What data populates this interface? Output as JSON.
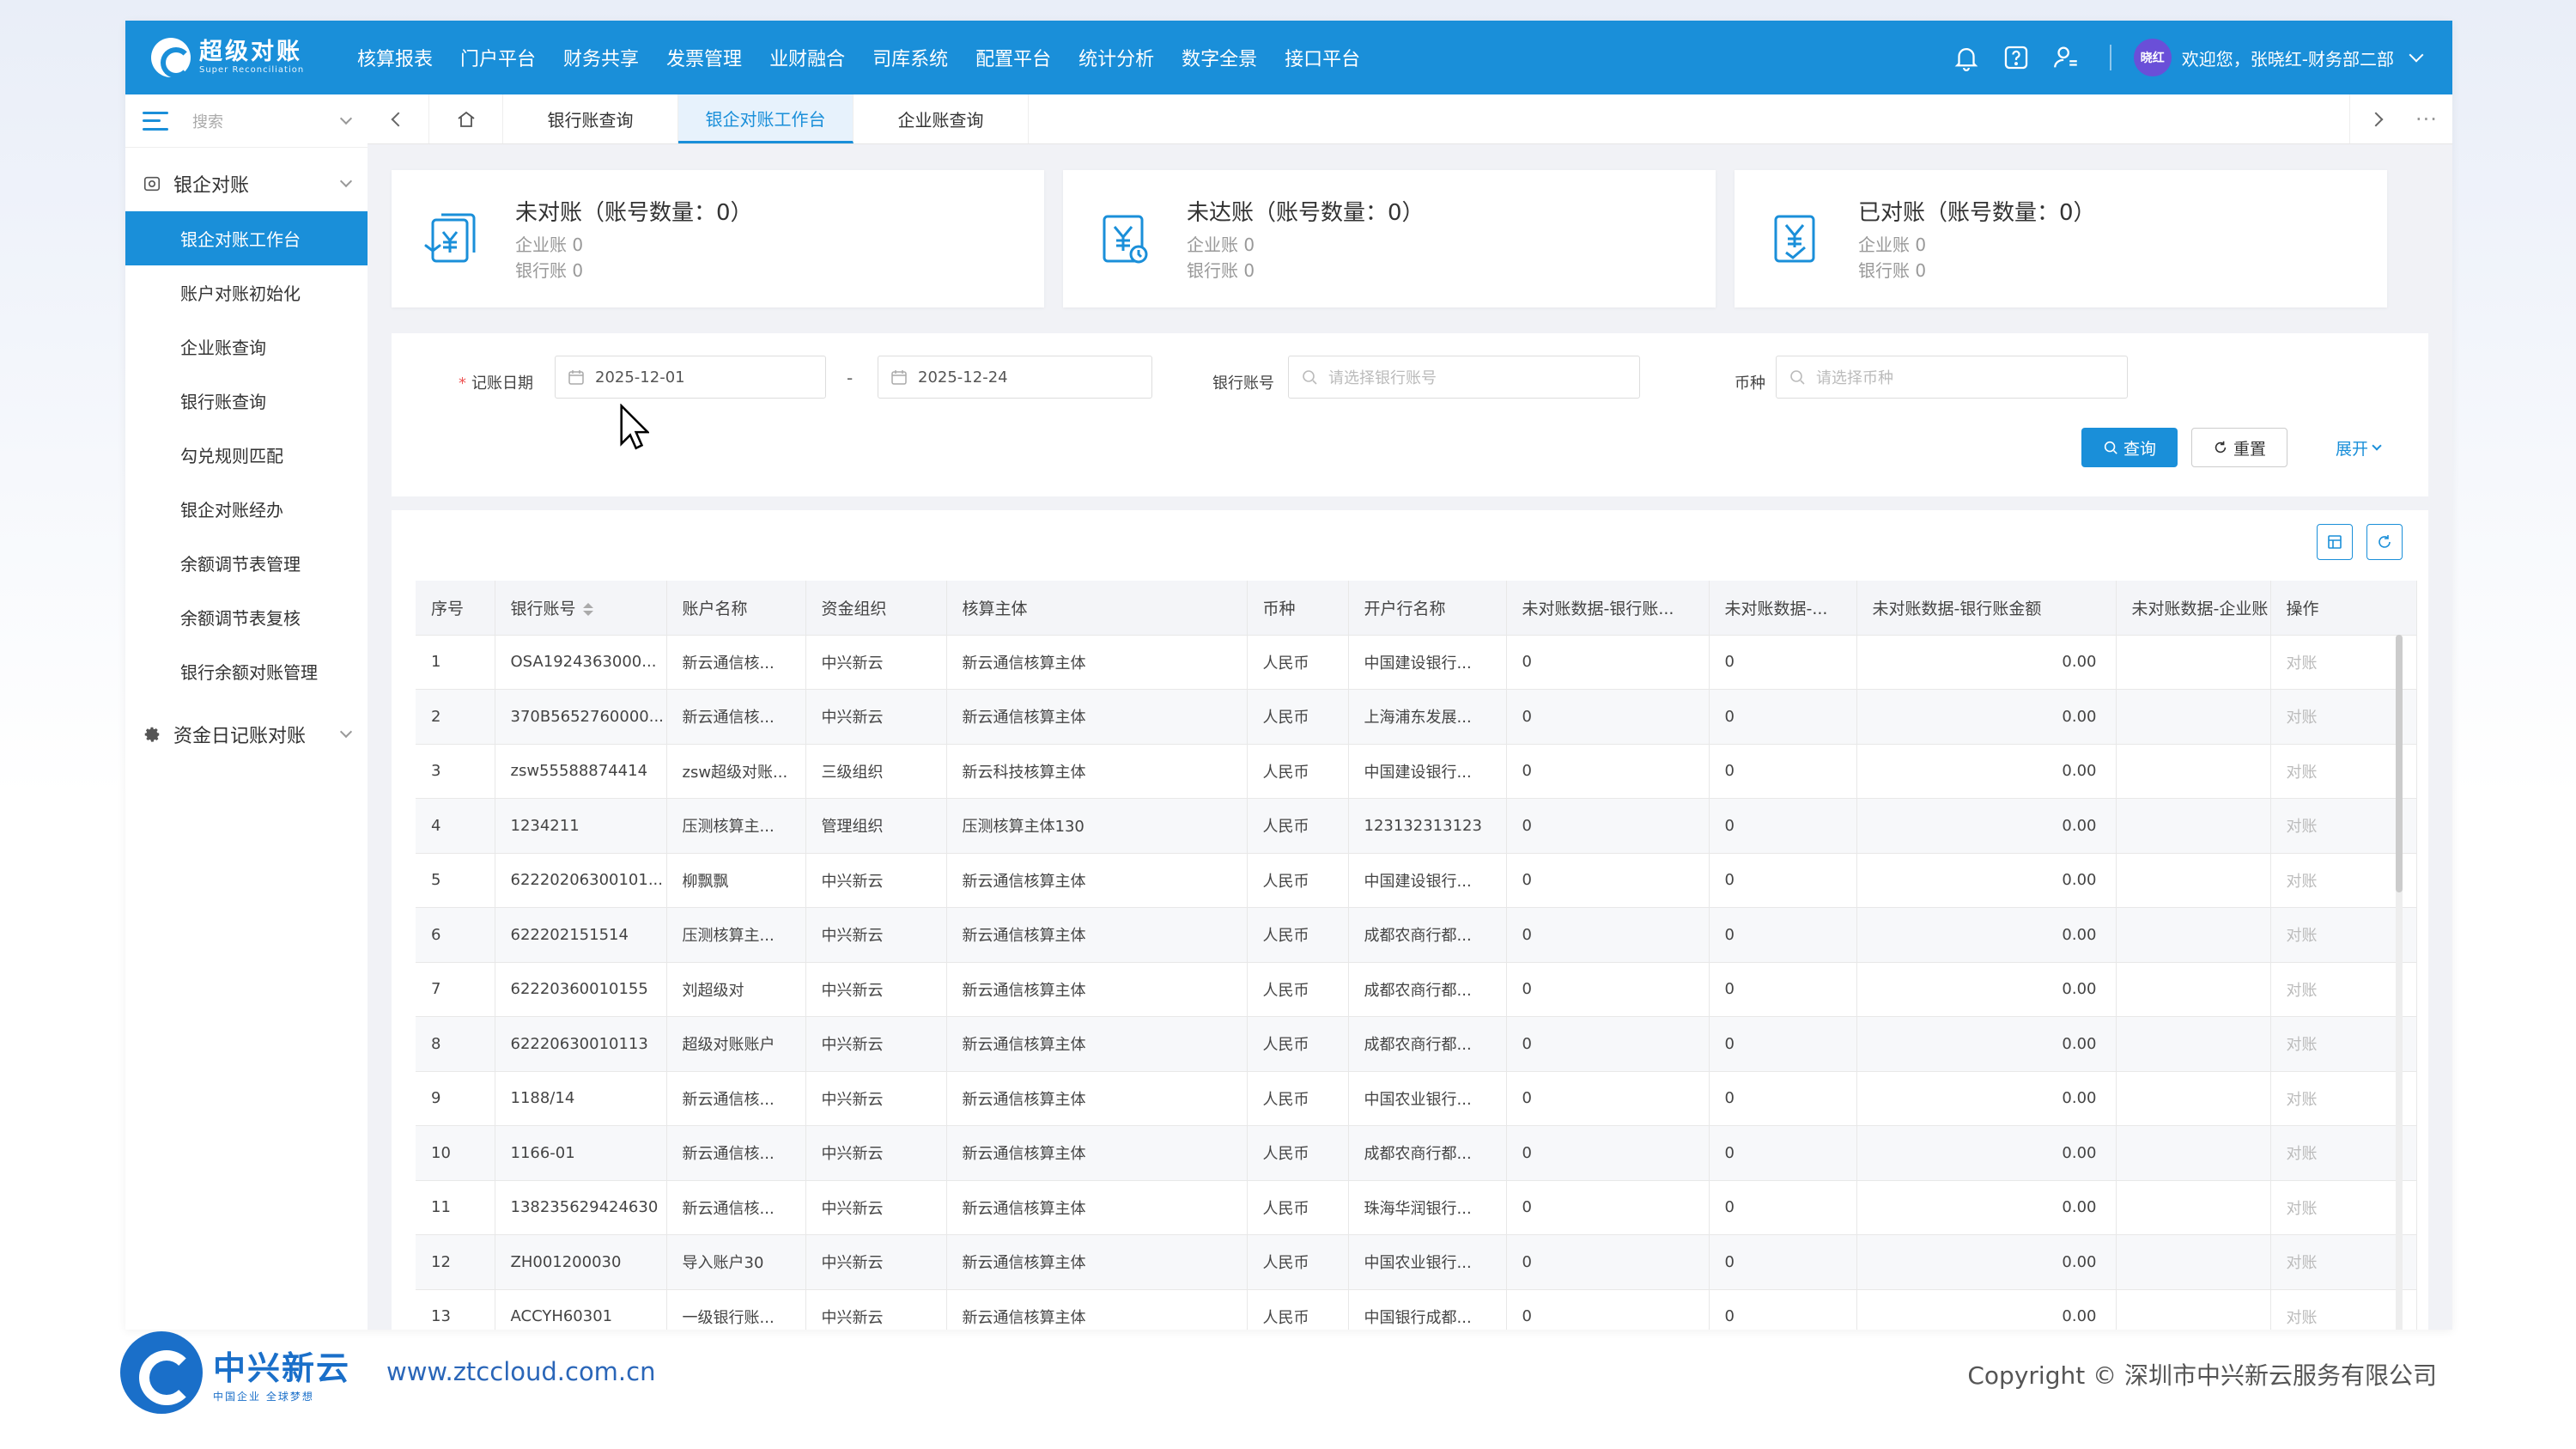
{
  "colors": {
    "primary": "#1a8fd9",
    "brand_footer": "#1a6fc9",
    "url": "#2a66b8"
  },
  "header": {
    "logo_title": "超级对账",
    "logo_subtitle": "Super Reconciliation",
    "nav": [
      "核算报表",
      "门户平台",
      "财务共享",
      "发票管理",
      "业财融合",
      "司库系统",
      "配置平台",
      "统计分析",
      "数字全景",
      "接口平台"
    ],
    "icons": [
      "bell-icon",
      "help-icon",
      "user-icon"
    ],
    "avatar_text": "晓红",
    "welcome": "欢迎您，张晓红-财务部二部"
  },
  "sidebar": {
    "search_placeholder": "搜索",
    "group1": "银企对账",
    "items": [
      "银企对账工作台",
      "账户对账初始化",
      "企业账查询",
      "银行账查询",
      "勾兑规则匹配",
      "银企对账经办",
      "余额调节表管理",
      "余额调节表复核",
      "银行余额对账管理"
    ],
    "active_index": 0,
    "group2": "资金日记账对账"
  },
  "tabs": {
    "items": [
      "银行账查询",
      "银企对账工作台",
      "企业账查询"
    ],
    "active_index": 1,
    "more": "···"
  },
  "cards": [
    {
      "title": "未对账（账号数量：0）",
      "line1": "企业账 0",
      "line2": "银行账 0"
    },
    {
      "title": "未达账（账号数量：0）",
      "line1": "企业账 0",
      "line2": "银行账 0"
    },
    {
      "title": "已对账（账号数量：0）",
      "line1": "企业账 0",
      "line2": "银行账 0"
    }
  ],
  "filter": {
    "date_label": "记账日期",
    "date_start": "2025-12-01",
    "date_sep": "-",
    "date_end": "2025-12-24",
    "account_label": "银行账号",
    "account_placeholder": "请选择银行账号",
    "currency_label": "币种",
    "currency_placeholder": "请选择币种",
    "query_btn": "查询",
    "reset_btn": "重置",
    "expand": "展开"
  },
  "table": {
    "headers": [
      "序号",
      "银行账号",
      "账户名称",
      "资金组织",
      "核算主体",
      "币种",
      "开户行名称",
      "未对账数据-银行账...",
      "未对账数据-...",
      "未对账数据-银行账金额",
      "未对账数据-企业账",
      "操作"
    ],
    "rows": [
      [
        "1",
        "OSA1924363000...",
        "新云通信核...",
        "中兴新云",
        "新云通信核算主体",
        "人民币",
        "中国建设银行...",
        "0",
        "0",
        "0.00",
        "",
        "对账"
      ],
      [
        "2",
        "370B5652760000...",
        "新云通信核...",
        "中兴新云",
        "新云通信核算主体",
        "人民币",
        "上海浦东发展...",
        "0",
        "0",
        "0.00",
        "",
        "对账"
      ],
      [
        "3",
        "zsw55588874414",
        "zsw超级对账...",
        "三级组织",
        "新云科技核算主体",
        "人民币",
        "中国建设银行...",
        "0",
        "0",
        "0.00",
        "",
        "对账"
      ],
      [
        "4",
        "1234211",
        "压测核算主...",
        "管理组织",
        "压测核算主体130",
        "人民币",
        "123132313123",
        "0",
        "0",
        "0.00",
        "",
        "对账"
      ],
      [
        "5",
        "62220206300101...",
        "柳飘飘",
        "中兴新云",
        "新云通信核算主体",
        "人民币",
        "中国建设银行...",
        "0",
        "0",
        "0.00",
        "",
        "对账"
      ],
      [
        "6",
        "622202151514",
        "压测核算主...",
        "中兴新云",
        "新云通信核算主体",
        "人民币",
        "成都农商行都...",
        "0",
        "0",
        "0.00",
        "",
        "对账"
      ],
      [
        "7",
        "62220360010155",
        "刘超级对",
        "中兴新云",
        "新云通信核算主体",
        "人民币",
        "成都农商行都...",
        "0",
        "0",
        "0.00",
        "",
        "对账"
      ],
      [
        "8",
        "62220630010113",
        "超级对账账户",
        "中兴新云",
        "新云通信核算主体",
        "人民币",
        "成都农商行都...",
        "0",
        "0",
        "0.00",
        "",
        "对账"
      ],
      [
        "9",
        "1188/14",
        "新云通信核...",
        "中兴新云",
        "新云通信核算主体",
        "人民币",
        "中国农业银行...",
        "0",
        "0",
        "0.00",
        "",
        "对账"
      ],
      [
        "10",
        "1166-01",
        "新云通信核...",
        "中兴新云",
        "新云通信核算主体",
        "人民币",
        "成都农商行都...",
        "0",
        "0",
        "0.00",
        "",
        "对账"
      ],
      [
        "11",
        "138235629424630",
        "新云通信核...",
        "中兴新云",
        "新云通信核算主体",
        "人民币",
        "珠海华润银行...",
        "0",
        "0",
        "0.00",
        "",
        "对账"
      ],
      [
        "12",
        "ZH001200030",
        "导入账户30",
        "中兴新云",
        "新云通信核算主体",
        "人民币",
        "中国农业银行...",
        "0",
        "0",
        "0.00",
        "",
        "对账"
      ],
      [
        "13",
        "ACCYH60301",
        "一级银行账...",
        "中兴新云",
        "新云通信核算主体",
        "人民币",
        "中国银行成都...",
        "0",
        "0",
        "0.00",
        "",
        "对账"
      ]
    ]
  },
  "footer": {
    "brand": "中兴新云",
    "slogan": "中国企业 全球梦想",
    "url": "www.ztccloud.com.cn",
    "copyright": "Copyright © 深圳市中兴新云服务有限公司"
  }
}
